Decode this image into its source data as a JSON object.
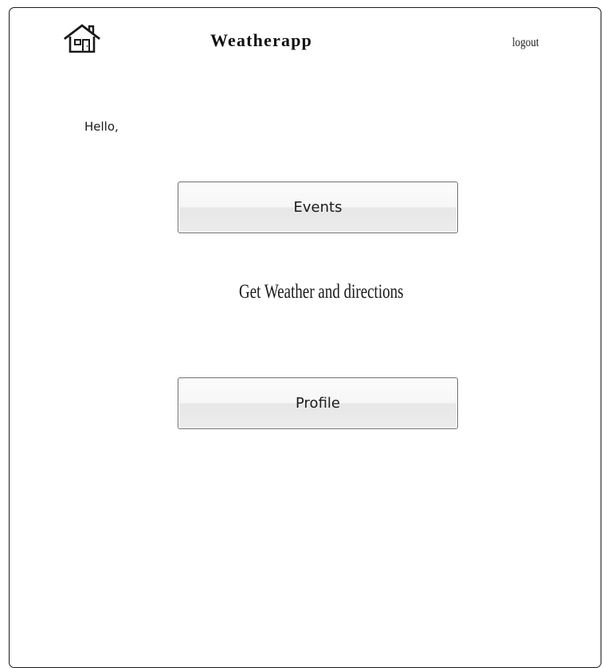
{
  "header": {
    "home_icon": "home-icon",
    "title": "Weatherapp",
    "logout_label": "logout"
  },
  "main": {
    "greeting": "Hello,",
    "events_button_label": "Events",
    "weather_link_label": "Get Weather and directions",
    "profile_button_label": "Profile"
  }
}
